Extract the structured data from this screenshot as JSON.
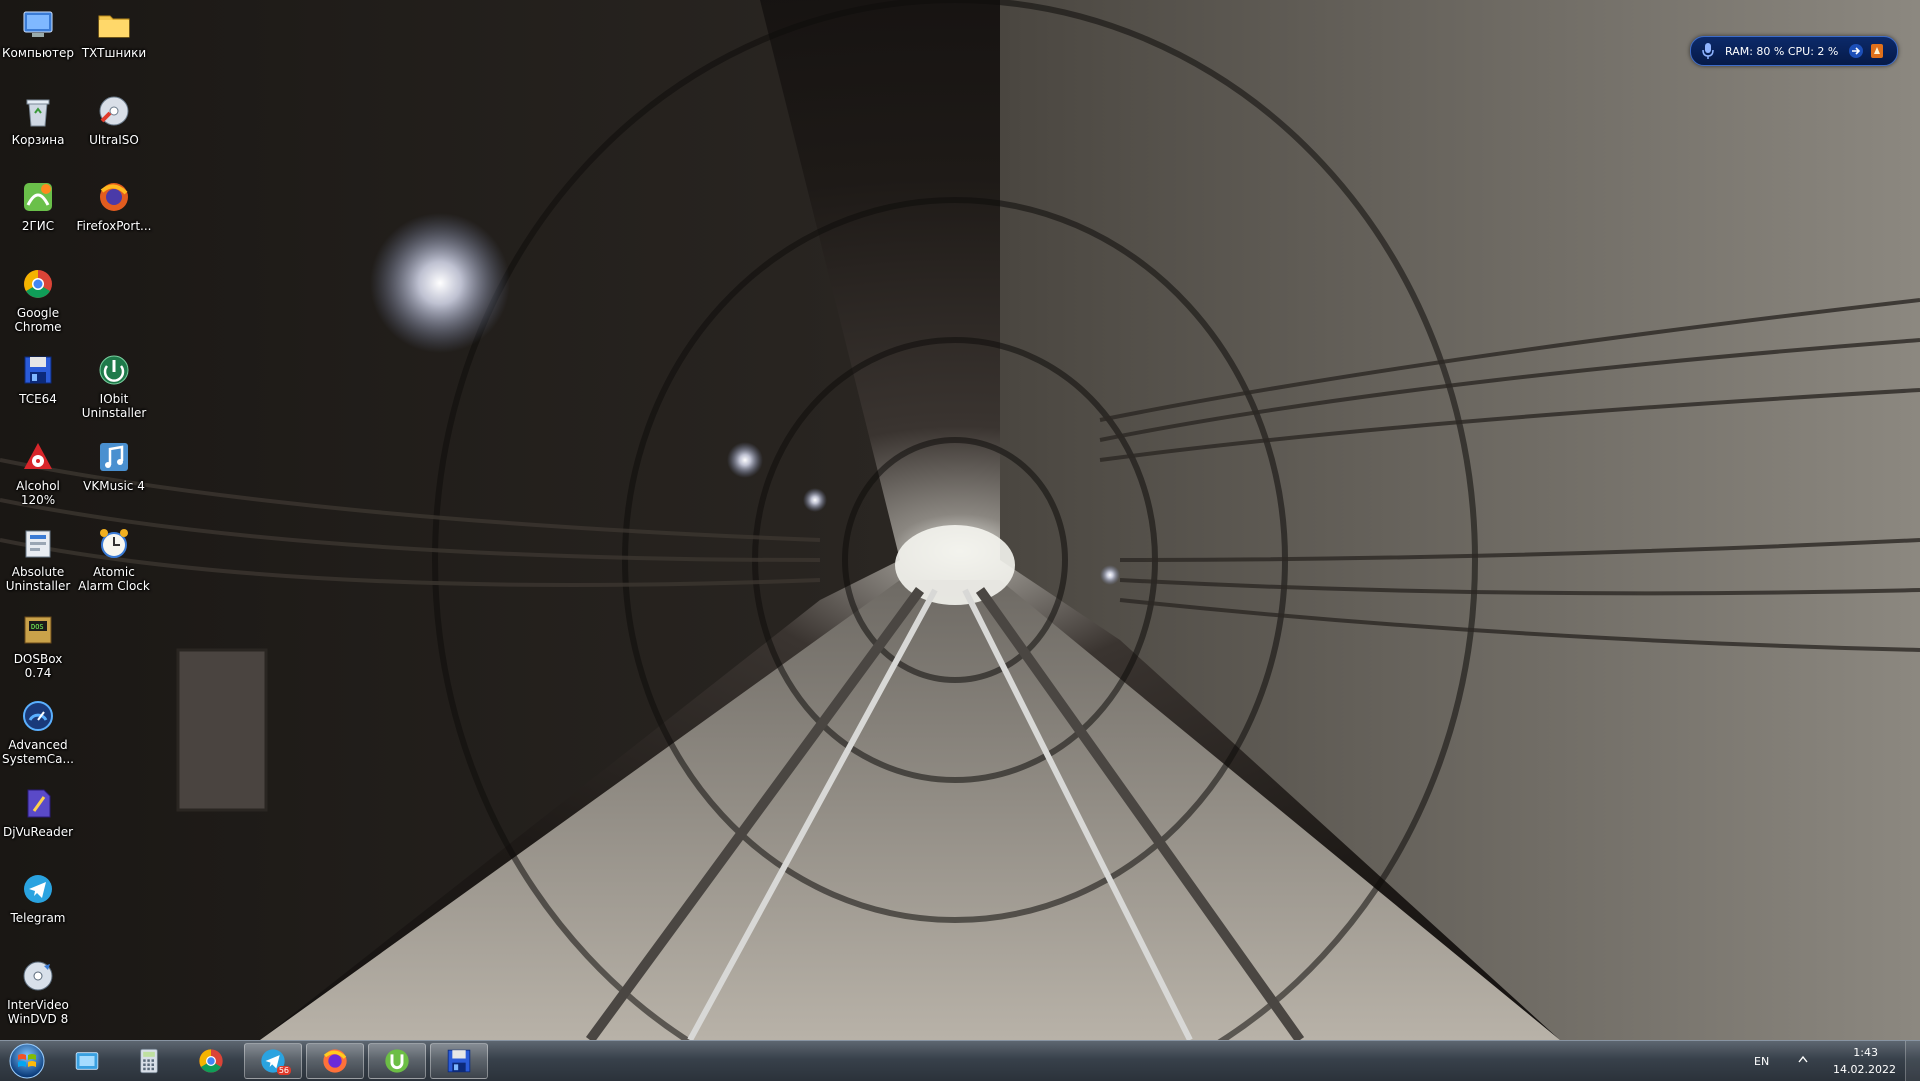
{
  "desktop": {
    "icons": [
      {
        "label": "Компьютер",
        "icon": "computer-icon"
      },
      {
        "label": "TXTшники",
        "icon": "folder-icon"
      },
      {
        "label": "Корзина",
        "icon": "recycle-bin-icon"
      },
      {
        "label": "UltraISO",
        "icon": "ultraiso-icon"
      },
      {
        "label": "2ГИС",
        "icon": "2gis-icon"
      },
      {
        "label": "FirefoxPort...",
        "icon": "firefox-portable-icon"
      },
      {
        "label": "Google Chrome",
        "icon": "chrome-icon"
      },
      {
        "label": "TCE64",
        "icon": "total-commander-icon"
      },
      {
        "label": "IObit Uninstaller",
        "icon": "iobit-uninstaller-icon"
      },
      {
        "label": "Alcohol 120%",
        "icon": "alcohol-icon"
      },
      {
        "label": "VKMusic 4",
        "icon": "vkmusic-icon"
      },
      {
        "label": "Absolute Uninstaller",
        "icon": "absolute-uninstaller-icon"
      },
      {
        "label": "Atomic Alarm Clock",
        "icon": "alarm-clock-icon"
      },
      {
        "label": "DOSBox 0.74",
        "icon": "dosbox-icon"
      },
      {
        "label": "Advanced SystemCa...",
        "icon": "advanced-systemcare-icon"
      },
      {
        "label": "DjVuReader",
        "icon": "djvureader-icon"
      },
      {
        "label": "Telegram",
        "icon": "telegram-icon"
      },
      {
        "label": "InterVideo WinDVD 8",
        "icon": "windvd-icon"
      }
    ]
  },
  "sysmon": {
    "text": "RAM: 80 %   CPU: 2 %"
  },
  "taskbar": {
    "start_icon": "windows-start-icon",
    "buttons": [
      {
        "icon": "explorer-icon"
      },
      {
        "icon": "calculator-icon"
      },
      {
        "icon": "chrome-icon"
      },
      {
        "icon": "telegram-icon",
        "badge": "56"
      },
      {
        "icon": "firefox-icon"
      },
      {
        "icon": "utorrent-icon"
      },
      {
        "icon": "total-commander-icon"
      }
    ],
    "tray": {
      "lang": "EN",
      "time": "1:43",
      "date": "14.02.2022"
    }
  }
}
